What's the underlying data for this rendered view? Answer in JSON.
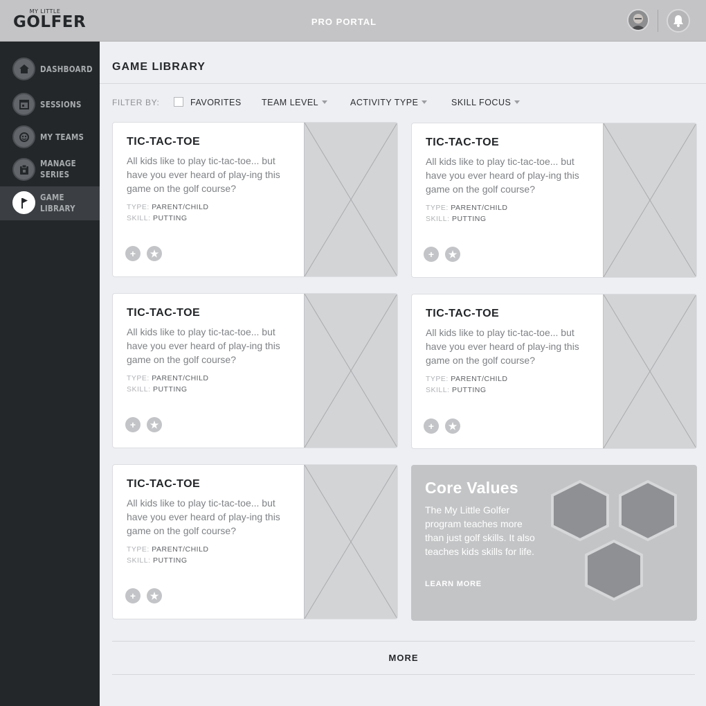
{
  "header": {
    "logo_small": "MY LITTLE",
    "logo_main": "GOLFER",
    "portal_title": "PRO PORTAL",
    "icons": {
      "avatar": "user-avatar",
      "notifications": "bell-icon"
    }
  },
  "sidebar": {
    "items": [
      {
        "label": "DASHBOARD",
        "icon": "home-icon"
      },
      {
        "label": "SESSIONS",
        "icon": "calendar-icon"
      },
      {
        "label": "MY TEAMS",
        "icon": "team-icon"
      },
      {
        "label": "MANAGE SERIES",
        "icon": "clipboard-icon"
      },
      {
        "label": "GAME LIBRARY",
        "icon": "flag-icon",
        "active": true
      }
    ]
  },
  "main": {
    "title": "GAME LIBRARY",
    "filter": {
      "label": "FILTER BY:",
      "favorites": "FAVORITES",
      "dropdowns": [
        "TEAM LEVEL",
        "ACTIVITY TYPE",
        "SKILL FOCUS"
      ]
    },
    "cards": [
      {
        "title": "TIC-TAC-TOE",
        "description": "All kids like to play tic-tac-toe... but have you ever heard of play-ing this game on the golf course?",
        "type_label": "TYPE:",
        "type": "PARENT/CHILD",
        "skill_label": "SKILL:",
        "skill": "PUTTING"
      },
      {
        "title": "TIC-TAC-TOE",
        "description": "All kids like to play tic-tac-toe... but have you ever heard of play-ing this game on the golf course?",
        "type_label": "TYPE:",
        "type": "PARENT/CHILD",
        "skill_label": "SKILL:",
        "skill": "PUTTING"
      },
      {
        "title": "TIC-TAC-TOE",
        "description": "All kids like to play tic-tac-toe... but have you ever heard of play-ing this game on the golf course?",
        "type_label": "TYPE:",
        "type": "PARENT/CHILD",
        "skill_label": "SKILL:",
        "skill": "PUTTING"
      },
      {
        "title": "TIC-TAC-TOE",
        "description": "All kids like to play tic-tac-toe... but have you ever heard of play-ing this game on the golf course?",
        "type_label": "TYPE:",
        "type": "PARENT/CHILD",
        "skill_label": "SKILL:",
        "skill": "PUTTING"
      },
      {
        "title": "TIC-TAC-TOE",
        "description": "All kids like to play tic-tac-toe... but have you ever heard of play-ing this game on the golf course?",
        "type_label": "TYPE:",
        "type": "PARENT/CHILD",
        "skill_label": "SKILL:",
        "skill": "PUTTING"
      }
    ],
    "core_values": {
      "title": "Core Values",
      "description": "The My Little Golfer program teaches more than just golf skills. It also teaches kids skills for life.",
      "link": "LEARN MORE"
    },
    "more_label": "MORE"
  },
  "colors": {
    "sidebar_bg": "#24272a",
    "topbar_bg": "#c4c4c6",
    "page_bg": "#eeeff3",
    "card_image_placeholder": "#d3d4d6",
    "core_values_bg": "#c3c4c6",
    "hexagon_fill": "#8f9093"
  }
}
